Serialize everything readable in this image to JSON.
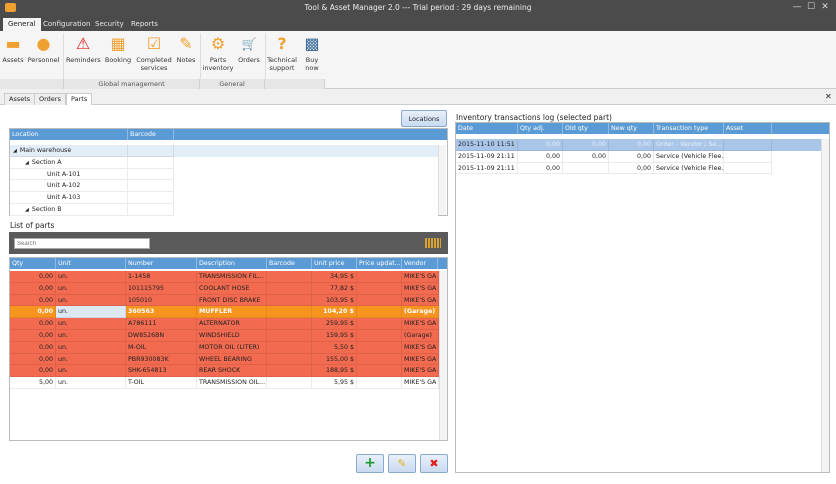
{
  "window": {
    "title": "Tool & Asset Manager 2.0 --- Trial period : 29 days remaining",
    "min": "—",
    "max": "☐",
    "close": "✕"
  },
  "ribbon_tabs": [
    "General",
    "Configuration",
    "Security",
    "Reports"
  ],
  "ribbon": {
    "buttons": [
      {
        "label": "Assets",
        "icon": "assets-icon",
        "glyph": "▬"
      },
      {
        "label": "Personnel",
        "icon": "person-icon",
        "glyph": "●"
      },
      {
        "label": "Reminders",
        "icon": "warning-icon",
        "glyph": "⚠"
      },
      {
        "label": "Booking",
        "icon": "calendar-icon",
        "glyph": "▦"
      },
      {
        "label": "Completed services",
        "icon": "checkbox-icon",
        "glyph": "☑"
      },
      {
        "label": "Notes",
        "icon": "note-icon",
        "glyph": "✎"
      },
      {
        "label": "Parts inventory",
        "icon": "gears-icon",
        "glyph": "⚙"
      },
      {
        "label": "Orders",
        "icon": "cart-icon",
        "glyph": "🛒"
      },
      {
        "label": "Technical support",
        "icon": "question-icon",
        "glyph": "?"
      },
      {
        "label": "Buy now",
        "icon": "buy-icon",
        "glyph": "▩"
      }
    ],
    "groups": [
      "Global management",
      "General"
    ]
  },
  "doc_tabs": [
    "Assets",
    "Orders",
    "Parts"
  ],
  "close_doc": "✕",
  "locations_button": "Locations",
  "location_tree": {
    "headers": [
      "Location",
      "Barcode"
    ],
    "nodes": [
      {
        "label": "Main warehouse",
        "level": 0,
        "arrow": "◢"
      },
      {
        "label": "Section A",
        "level": 1,
        "arrow": "◢"
      },
      {
        "label": "Unit A-101",
        "level": 2
      },
      {
        "label": "Unit A-102",
        "level": 2
      },
      {
        "label": "Unit A-103",
        "level": 2
      },
      {
        "label": "Section B",
        "level": 1,
        "arrow": "◢"
      }
    ]
  },
  "parts": {
    "title": "List of parts",
    "search_placeholder": "Search",
    "headers": [
      "Qty",
      "Unit",
      "Number",
      "Description",
      "Barcode",
      "Unit price",
      "Price updat...",
      "Vendor"
    ],
    "rows": [
      {
        "qty": "0,00",
        "unit": "un.",
        "number": "1-1458",
        "desc": "TRANSMISSION FIL...",
        "barcode": "",
        "price": "34,95 $",
        "updated": "",
        "vendor": "MIKE'S GA",
        "state": "red"
      },
      {
        "qty": "0,00",
        "unit": "un.",
        "number": "101115795",
        "desc": "COOLANT HOSE",
        "barcode": "",
        "price": "77,82 $",
        "updated": "",
        "vendor": "MIKE'S GA",
        "state": "red"
      },
      {
        "qty": "0,00",
        "unit": "un.",
        "number": "105010",
        "desc": "FRONT DISC BRAKE",
        "barcode": "",
        "price": "103,95 $",
        "updated": "",
        "vendor": "MIKE'S GA",
        "state": "red"
      },
      {
        "qty": "0,00",
        "unit": "un.",
        "number": "360563",
        "desc": "MUFFLER",
        "barcode": "",
        "price": "104,20 $",
        "updated": "",
        "vendor": "(Garage)",
        "state": "selected"
      },
      {
        "qty": "0,00",
        "unit": "un.",
        "number": "A786111",
        "desc": "ALTERNATOR",
        "barcode": "",
        "price": "259,95 $",
        "updated": "",
        "vendor": "MIKE'S GA",
        "state": "red"
      },
      {
        "qty": "0,00",
        "unit": "un.",
        "number": "DW8526BN",
        "desc": "WINDSHIELD",
        "barcode": "",
        "price": "159,95 $",
        "updated": "",
        "vendor": "(Garage)",
        "state": "red"
      },
      {
        "qty": "0,00",
        "unit": "un.",
        "number": "M-OIL",
        "desc": "MOTOR OIL (LITER)",
        "barcode": "",
        "price": "5,50 $",
        "updated": "",
        "vendor": "MIKE'S GA",
        "state": "red"
      },
      {
        "qty": "0,00",
        "unit": "un.",
        "number": "PBR930083K",
        "desc": "WHEEL BEARING",
        "barcode": "",
        "price": "155,00 $",
        "updated": "",
        "vendor": "MIKE'S GA",
        "state": "red"
      },
      {
        "qty": "0,00",
        "unit": "un.",
        "number": "SHK-654813",
        "desc": "REAR SHOCK",
        "barcode": "",
        "price": "188,95 $",
        "updated": "",
        "vendor": "MIKE'S GA",
        "state": "red"
      },
      {
        "qty": "5,00",
        "unit": "un.",
        "number": "T-OIL",
        "desc": "TRANSMISSION OIL...",
        "barcode": "",
        "price": "5,95 $",
        "updated": "",
        "vendor": "MIKE'S GA",
        "state": "normal"
      }
    ]
  },
  "actions": {
    "add": "+",
    "edit": "✎",
    "delete": "✖"
  },
  "transactions": {
    "title": "Inventory transactions log (selected part)",
    "headers": [
      "Date",
      "Qty adj.",
      "Old qty",
      "New qty",
      "Transaction type",
      "Asset"
    ],
    "rows": [
      {
        "date": "2015-11-10 11:51",
        "adj": "0,00",
        "old": "0,00",
        "new": "0,00",
        "type": "Order - Vendor / Se...",
        "asset": "",
        "selected": true
      },
      {
        "date": "2015-11-09 21:11",
        "adj": "0,00",
        "old": "0,00",
        "new": "0,00",
        "type": "Service (Vehicle Flee...",
        "asset": ""
      },
      {
        "date": "2015-11-09 21:11",
        "adj": "0,00",
        "old": "",
        "new": "0,00",
        "type": "Service (Vehicle Flee...",
        "asset": ""
      }
    ]
  },
  "colors": {
    "red": "#f26a4f",
    "selected": "#f7941d",
    "header": "#5b9bd5"
  }
}
